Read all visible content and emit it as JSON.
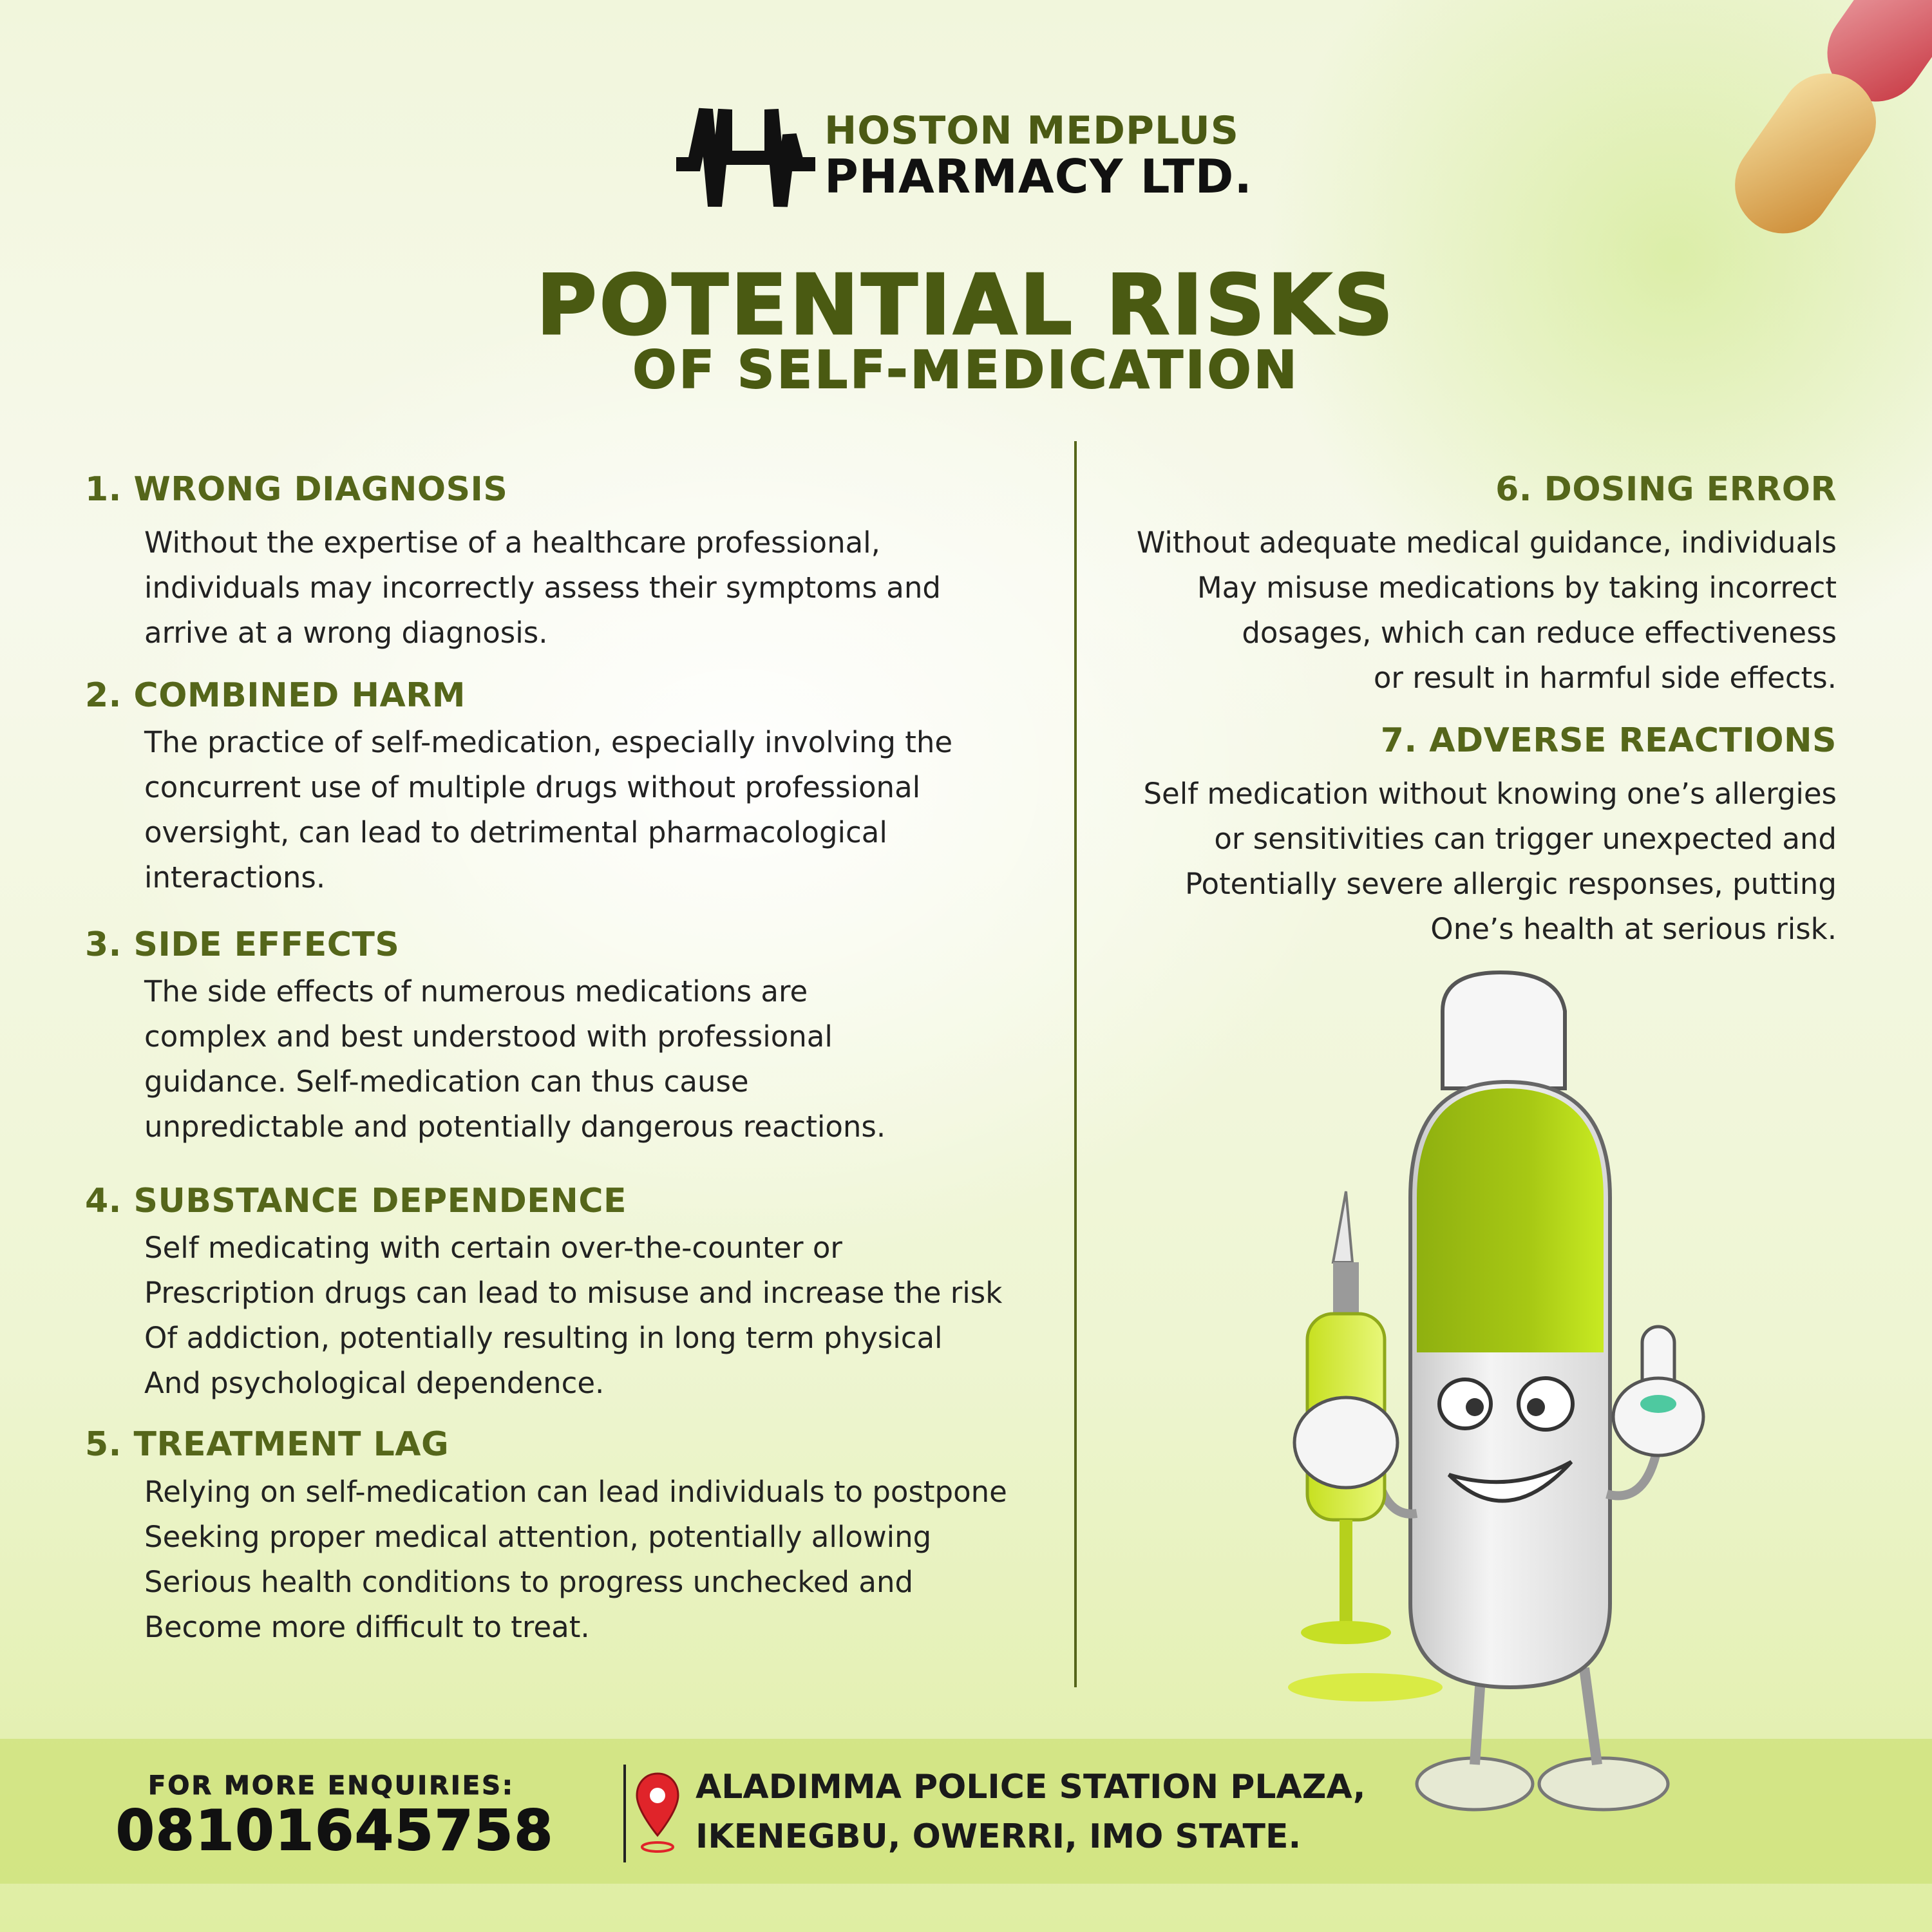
{
  "brand": {
    "line1": "HOSTON MEDPLUS",
    "line2": "PHARMACY LTD.",
    "logo_icon": "heartbeat-h-logo"
  },
  "title": "POTENTIAL RISKS",
  "subtitle": "OF SELF-MEDICATION",
  "colors": {
    "accent_dark": "#4a5a12",
    "accent_lime": "#b9dc12",
    "footer_band": "#cde278",
    "pin_red": "#e0242a"
  },
  "risks_left": [
    {
      "heading": "1. WRONG DIAGNOSIS",
      "lines": [
        "Without the expertise of a healthcare professional,",
        "individuals may incorrectly assess their symptoms and",
        "arrive at a wrong diagnosis."
      ]
    },
    {
      "heading": "2. COMBINED HARM",
      "lines": [
        "The practice of self-medication, especially involving the",
        "concurrent use of multiple drugs without professional",
        "oversight, can lead to detrimental pharmacological",
        "interactions."
      ]
    },
    {
      "heading": "3. SIDE EFFECTS",
      "lines": [
        "The side effects of numerous medications are",
        "complex and best understood with professional",
        "guidance. Self-medication can thus cause",
        "unpredictable and potentially dangerous reactions."
      ]
    },
    {
      "heading": "4. SUBSTANCE DEPENDENCE",
      "lines": [
        "Self medicating with certain over-the-counter or",
        "Prescription drugs can lead to misuse and increase the risk",
        "Of addiction, potentially resulting in long term physical",
        "And psychological dependence."
      ]
    },
    {
      "heading": "5. TREATMENT LAG",
      "lines": [
        "Relying on self-medication can lead individuals to postpone",
        "Seeking proper medical attention, potentially allowing",
        "Serious health conditions to progress unchecked and",
        "Become more difficult to treat."
      ]
    }
  ],
  "risks_right": [
    {
      "heading": "6. DOSING ERROR",
      "lines": [
        "Without adequate medical guidance, individuals",
        "May misuse medications by taking incorrect",
        "dosages, which can reduce effectiveness",
        "or result in harmful side effects."
      ]
    },
    {
      "heading": "7. ADVERSE REACTIONS",
      "lines": [
        "Self medication without knowing one’s allergies",
        "or sensitivities can trigger unexpected and",
        "Potentially severe allergic responses, putting",
        "One’s health at serious risk."
      ]
    }
  ],
  "footer": {
    "enquiries_label": "FOR MORE ENQUIRIES:",
    "phone": "08101645758",
    "address_line1": "ALADIMMA POLICE STATION PLAZA,",
    "address_line2": "IKENEGBU, OWERRI, IMO STATE.",
    "address_icon": "location-pin-icon"
  },
  "illustrations": {
    "mascot": "capsule-mascot-with-syringe",
    "decoration": "capsule-pill-decoration"
  }
}
